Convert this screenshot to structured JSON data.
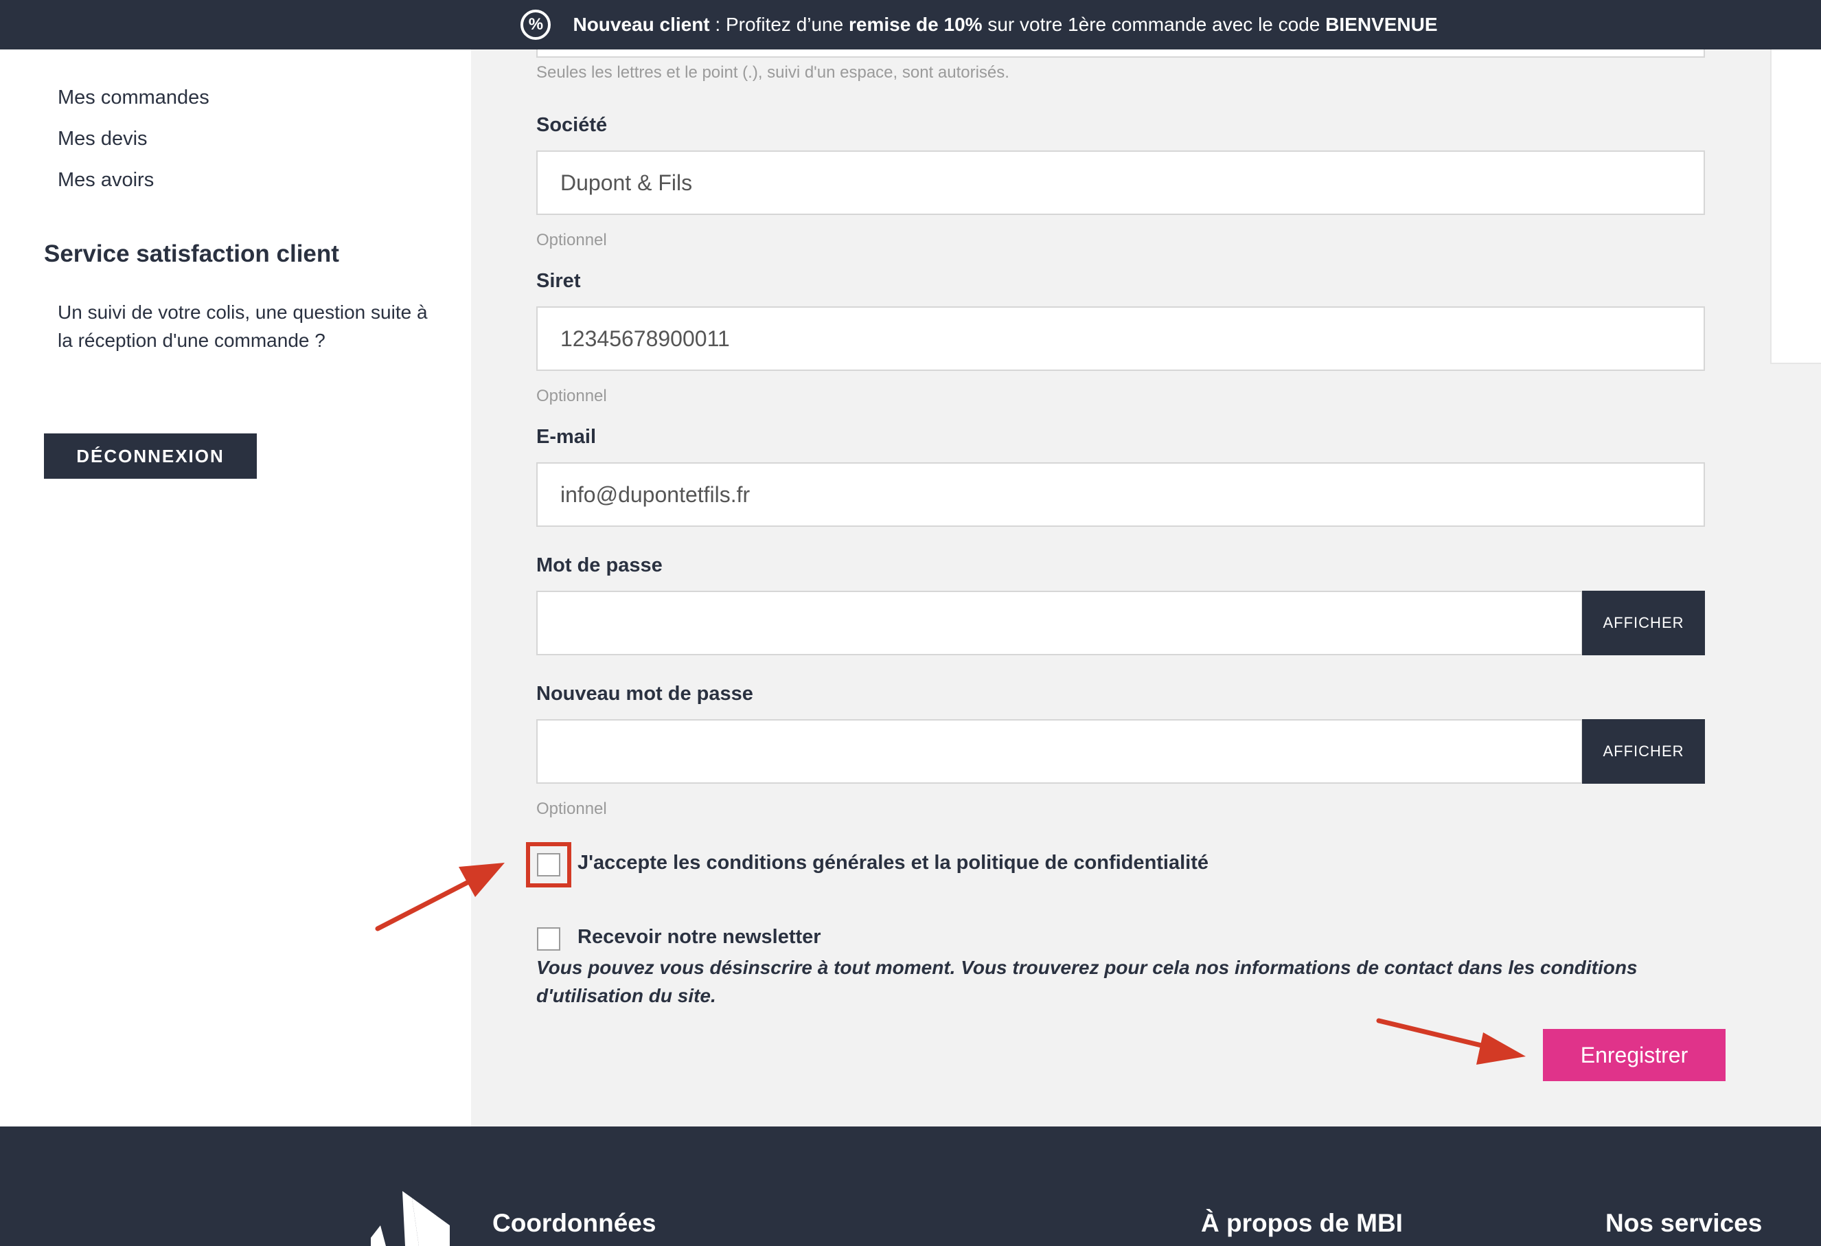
{
  "promo": {
    "icon": "percent-badge-icon",
    "lead": "Nouveau client",
    "sep": " : ",
    "text1": "Profitez d’une ",
    "bold1": "remise de 10%",
    "text2": " sur votre 1ère commande avec le code ",
    "code": "BIENVENUE"
  },
  "sidebar": {
    "links": [
      "Mes commandes",
      "Mes devis",
      "Mes avoirs"
    ],
    "service_heading": "Service satisfaction client",
    "service_text": "Un suivi de votre colis, une question suite à la réception d'une commande ?",
    "logout_label": "DÉCONNEXION"
  },
  "form": {
    "name_hint": "Seules les lettres et le point (.), suivi d'un espace, sont autorisés.",
    "company_label": "Société",
    "company_value": "Dupont & Fils",
    "company_hint": "Optionnel",
    "siret_label": "Siret",
    "siret_value": "12345678900011",
    "siret_hint": "Optionnel",
    "email_label": "E-mail",
    "email_value": "info@dupontetfils.fr",
    "password_label": "Mot de passe",
    "password_show": "AFFICHER",
    "new_password_label": "Nouveau mot de passe",
    "new_password_show": "AFFICHER",
    "new_password_hint": "Optionnel",
    "terms_label": "J'accepte les conditions générales et la politique de confidentialité",
    "newsletter_label": "Recevoir notre newsletter",
    "newsletter_note": "Vous pouvez vous désinscrire à tout moment. Vous trouverez pour cela nos informations de contact dans les conditions d'utilisation du site.",
    "save_label": "Enregistrer"
  },
  "footer": {
    "col1": "Coordonnées",
    "col2": "À propos de MBI",
    "col3": "Nos services"
  },
  "colors": {
    "dark": "#2a3140",
    "accent": "#e0338a",
    "annotation": "#d33a25"
  }
}
